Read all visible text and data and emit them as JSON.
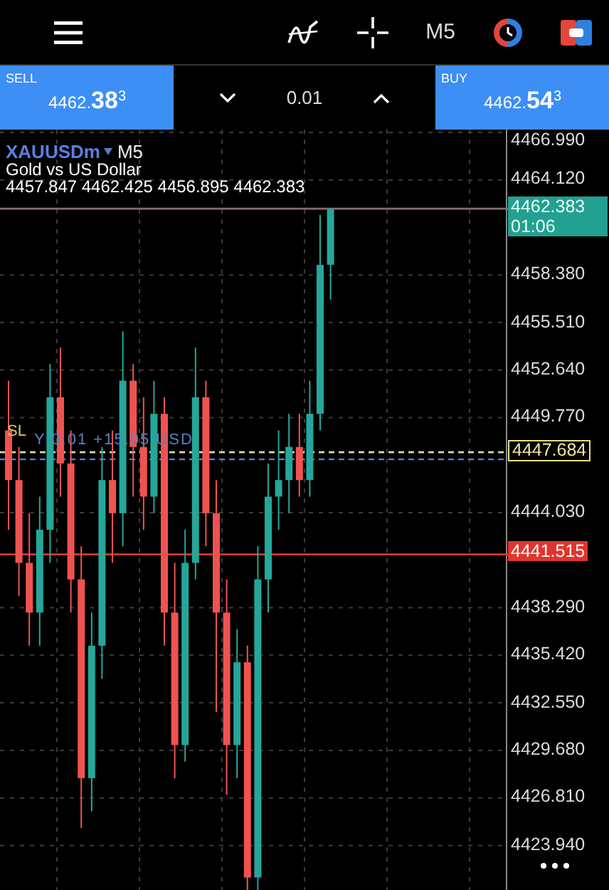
{
  "toolbar": {
    "timeframe": "M5"
  },
  "trade_panel": {
    "sell": {
      "label": "SELL",
      "price_small": "4462.",
      "price_big": "38",
      "price_sup": "3"
    },
    "volume": "0.01",
    "buy": {
      "label": "BUY",
      "price_small": "4462.",
      "price_big": "54",
      "price_sup": "3"
    }
  },
  "chart": {
    "symbol": "XAUUSDm",
    "timeframe": "M5",
    "description": "Gold vs US Dollar",
    "ohlc": "4457.847 4462.425 4456.895 4462.383",
    "price_axis": [
      "4466.990",
      "4464.120",
      "4458.380",
      "4455.510",
      "4452.640",
      "4449.770",
      "4444.030",
      "4438.290",
      "4435.420",
      "4432.550",
      "4429.680",
      "4426.810",
      "4423.940"
    ],
    "markers": [
      {
        "kind": "bid",
        "price": "4462.383",
        "timer": "01:06"
      },
      {
        "kind": "position",
        "price": "4447.684"
      },
      {
        "kind": "stop",
        "price": "4441.515"
      }
    ],
    "sl_label": "SL",
    "position_label": "Y 0.01  +15.05 USD"
  }
}
